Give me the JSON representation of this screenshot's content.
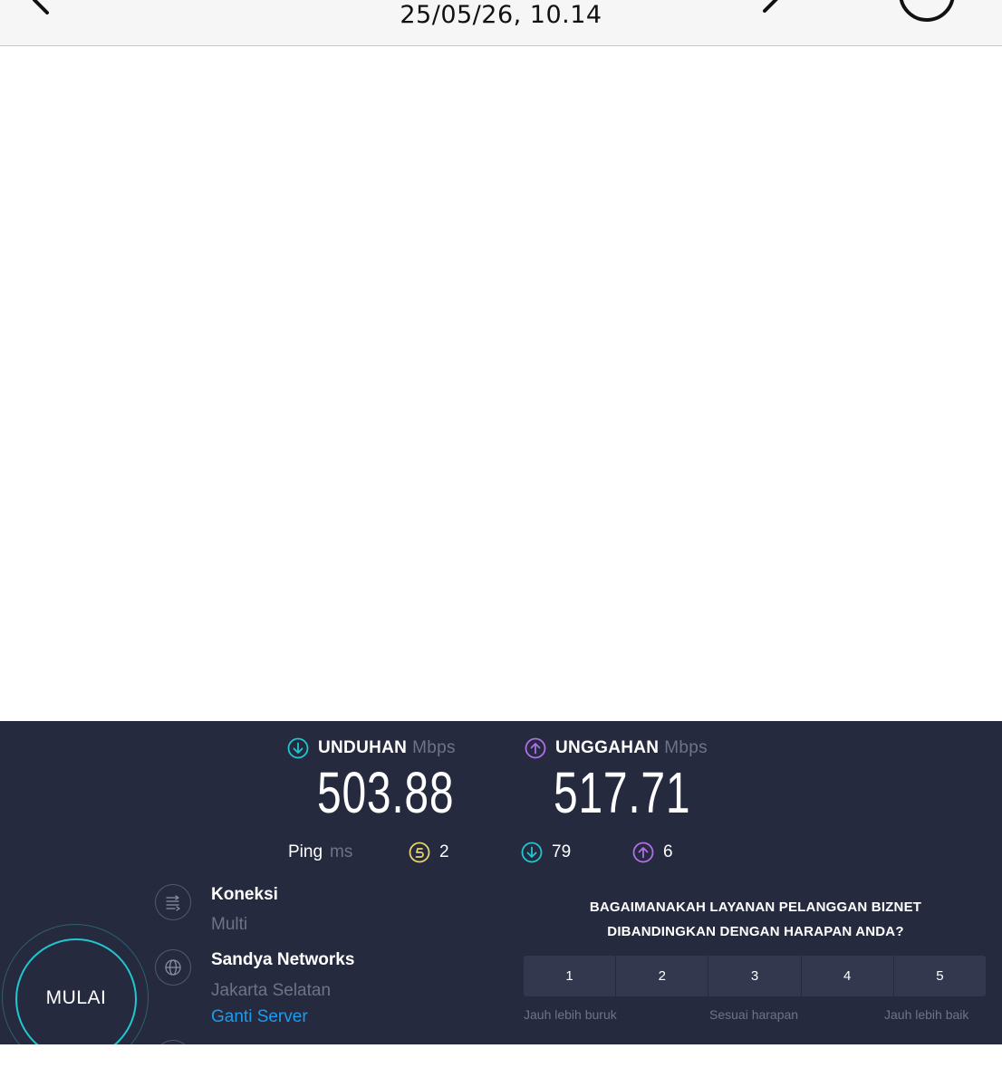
{
  "header": {
    "datetime": "25/05/26, 10.14"
  },
  "speedtest": {
    "download": {
      "label": "UNDUHAN",
      "unit": "Mbps",
      "value": "503.88"
    },
    "upload": {
      "label": "UNGGAHAN",
      "unit": "Mbps",
      "value": "517.71"
    },
    "ping": {
      "label": "Ping",
      "unit": "ms",
      "idle": "2",
      "download": "79",
      "upload": "6"
    },
    "start_label": "MULAI",
    "connection": {
      "title": "Koneksi",
      "value": "Multi"
    },
    "server": {
      "name": "Sandya Networks",
      "location": "Jakarta Selatan",
      "change_label": "Ganti Server"
    },
    "survey": {
      "question_line1": "BAGAIMANAKAH LAYANAN PELANGGAN BIZNET",
      "question_line2": "DIBANDINGKAN DENGAN HARAPAN ANDA?",
      "options": [
        "1",
        "2",
        "3",
        "4",
        "5"
      ],
      "label_low": "Jauh lebih buruk",
      "label_mid": "Sesuai harapan",
      "label_high": "Jauh lebih baik"
    },
    "colors": {
      "download": "#1fc7cf",
      "upload": "#b06ee8",
      "ping": "#e8d36b",
      "link": "#1c9cf0",
      "panel_bg": "#262a3f"
    }
  }
}
